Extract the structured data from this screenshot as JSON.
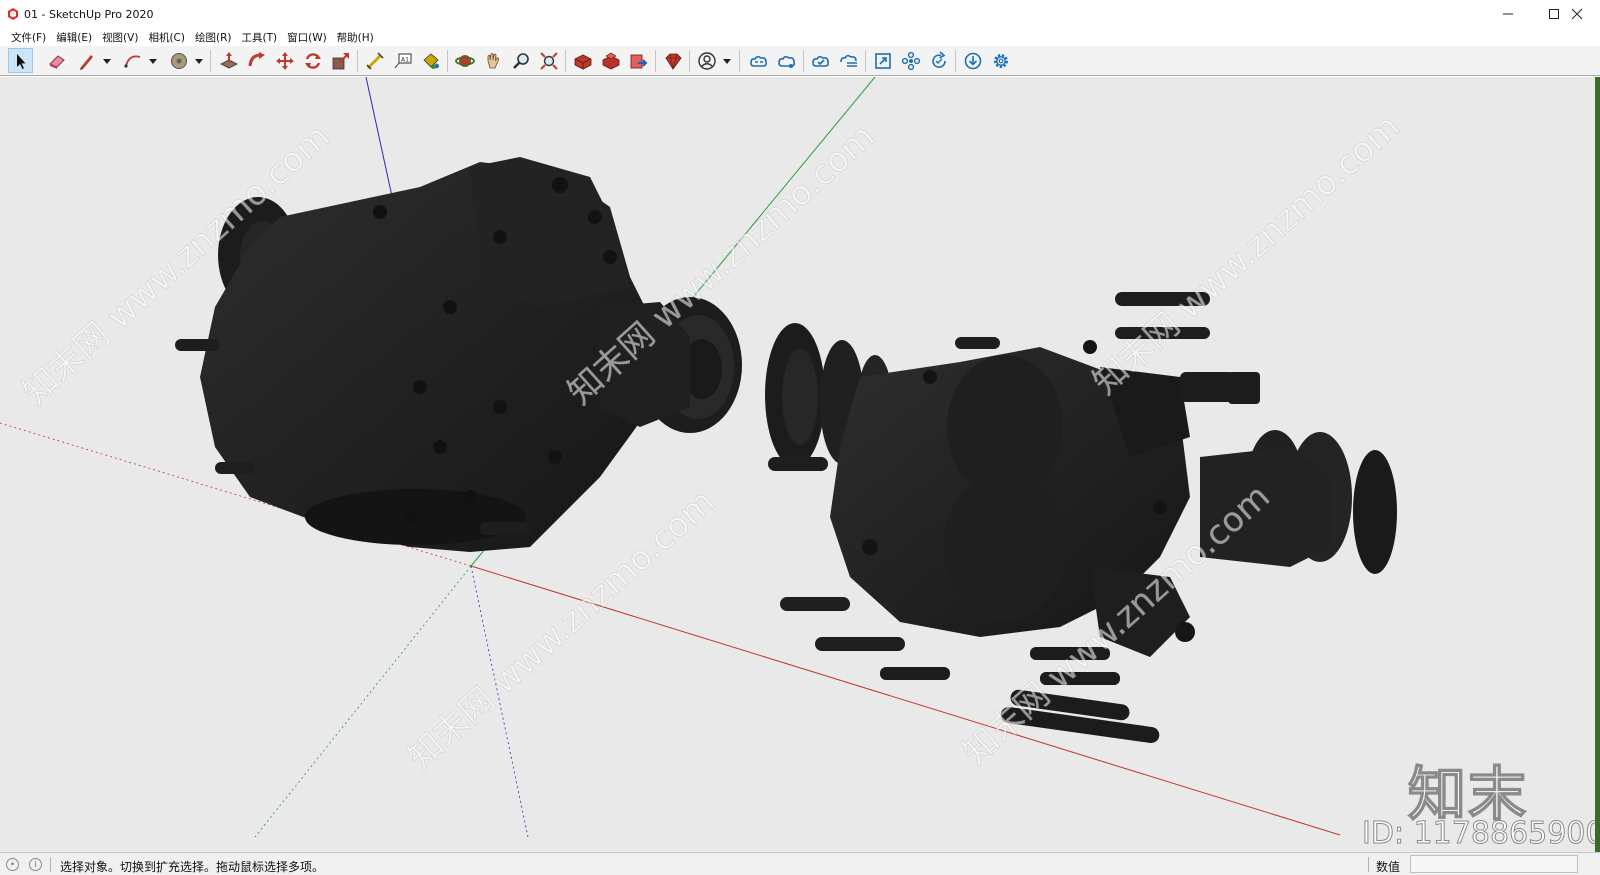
{
  "window": {
    "title": "01 - SketchUp Pro 2020"
  },
  "menu": [
    "文件(F)",
    "编辑(E)",
    "视图(V)",
    "相机(C)",
    "绘图(R)",
    "工具(T)",
    "窗口(W)",
    "帮助(H)"
  ],
  "toolbar": {
    "tools": [
      "select-arrow-icon",
      "eraser-icon",
      "pencil-line-icon",
      "arc-icon",
      "tape-measure-icon",
      "push-pull-icon",
      "follow-me-icon",
      "move-icon",
      "rotate-icon",
      "scale-icon",
      "dimension-icon",
      "text-label-icon",
      "paint-bucket-icon",
      "orbit-icon",
      "pan-hand-icon",
      "zoom-icon",
      "zoom-extents-icon",
      "3d-warehouse-icon",
      "extension-warehouse-icon",
      "layout-send-icon",
      "ruby-console-icon",
      "profile-icon",
      "trimble-connect-icon",
      "share-model-icon",
      "cloud-open-icon",
      "cloud-sync-icon",
      "model-info-icon",
      "components-icon",
      "refresh-icon",
      "download-icon",
      "settings-gear-icon"
    ],
    "accent_color": "#1e6fb8"
  },
  "viewport": {
    "watermark_brand": "知末",
    "watermark_id": "ID: 1178865900",
    "watermark_diagonal": "知末网 www.znzmo.com",
    "axis_colors": {
      "red": "#c0392b",
      "green": "#2e9a3a",
      "blue": "#2b2bb8"
    }
  },
  "status": {
    "message": "选择对象。切换到扩充选择。拖动鼠标选择多项。",
    "measurements_label": "数值",
    "measurements_value": ""
  }
}
